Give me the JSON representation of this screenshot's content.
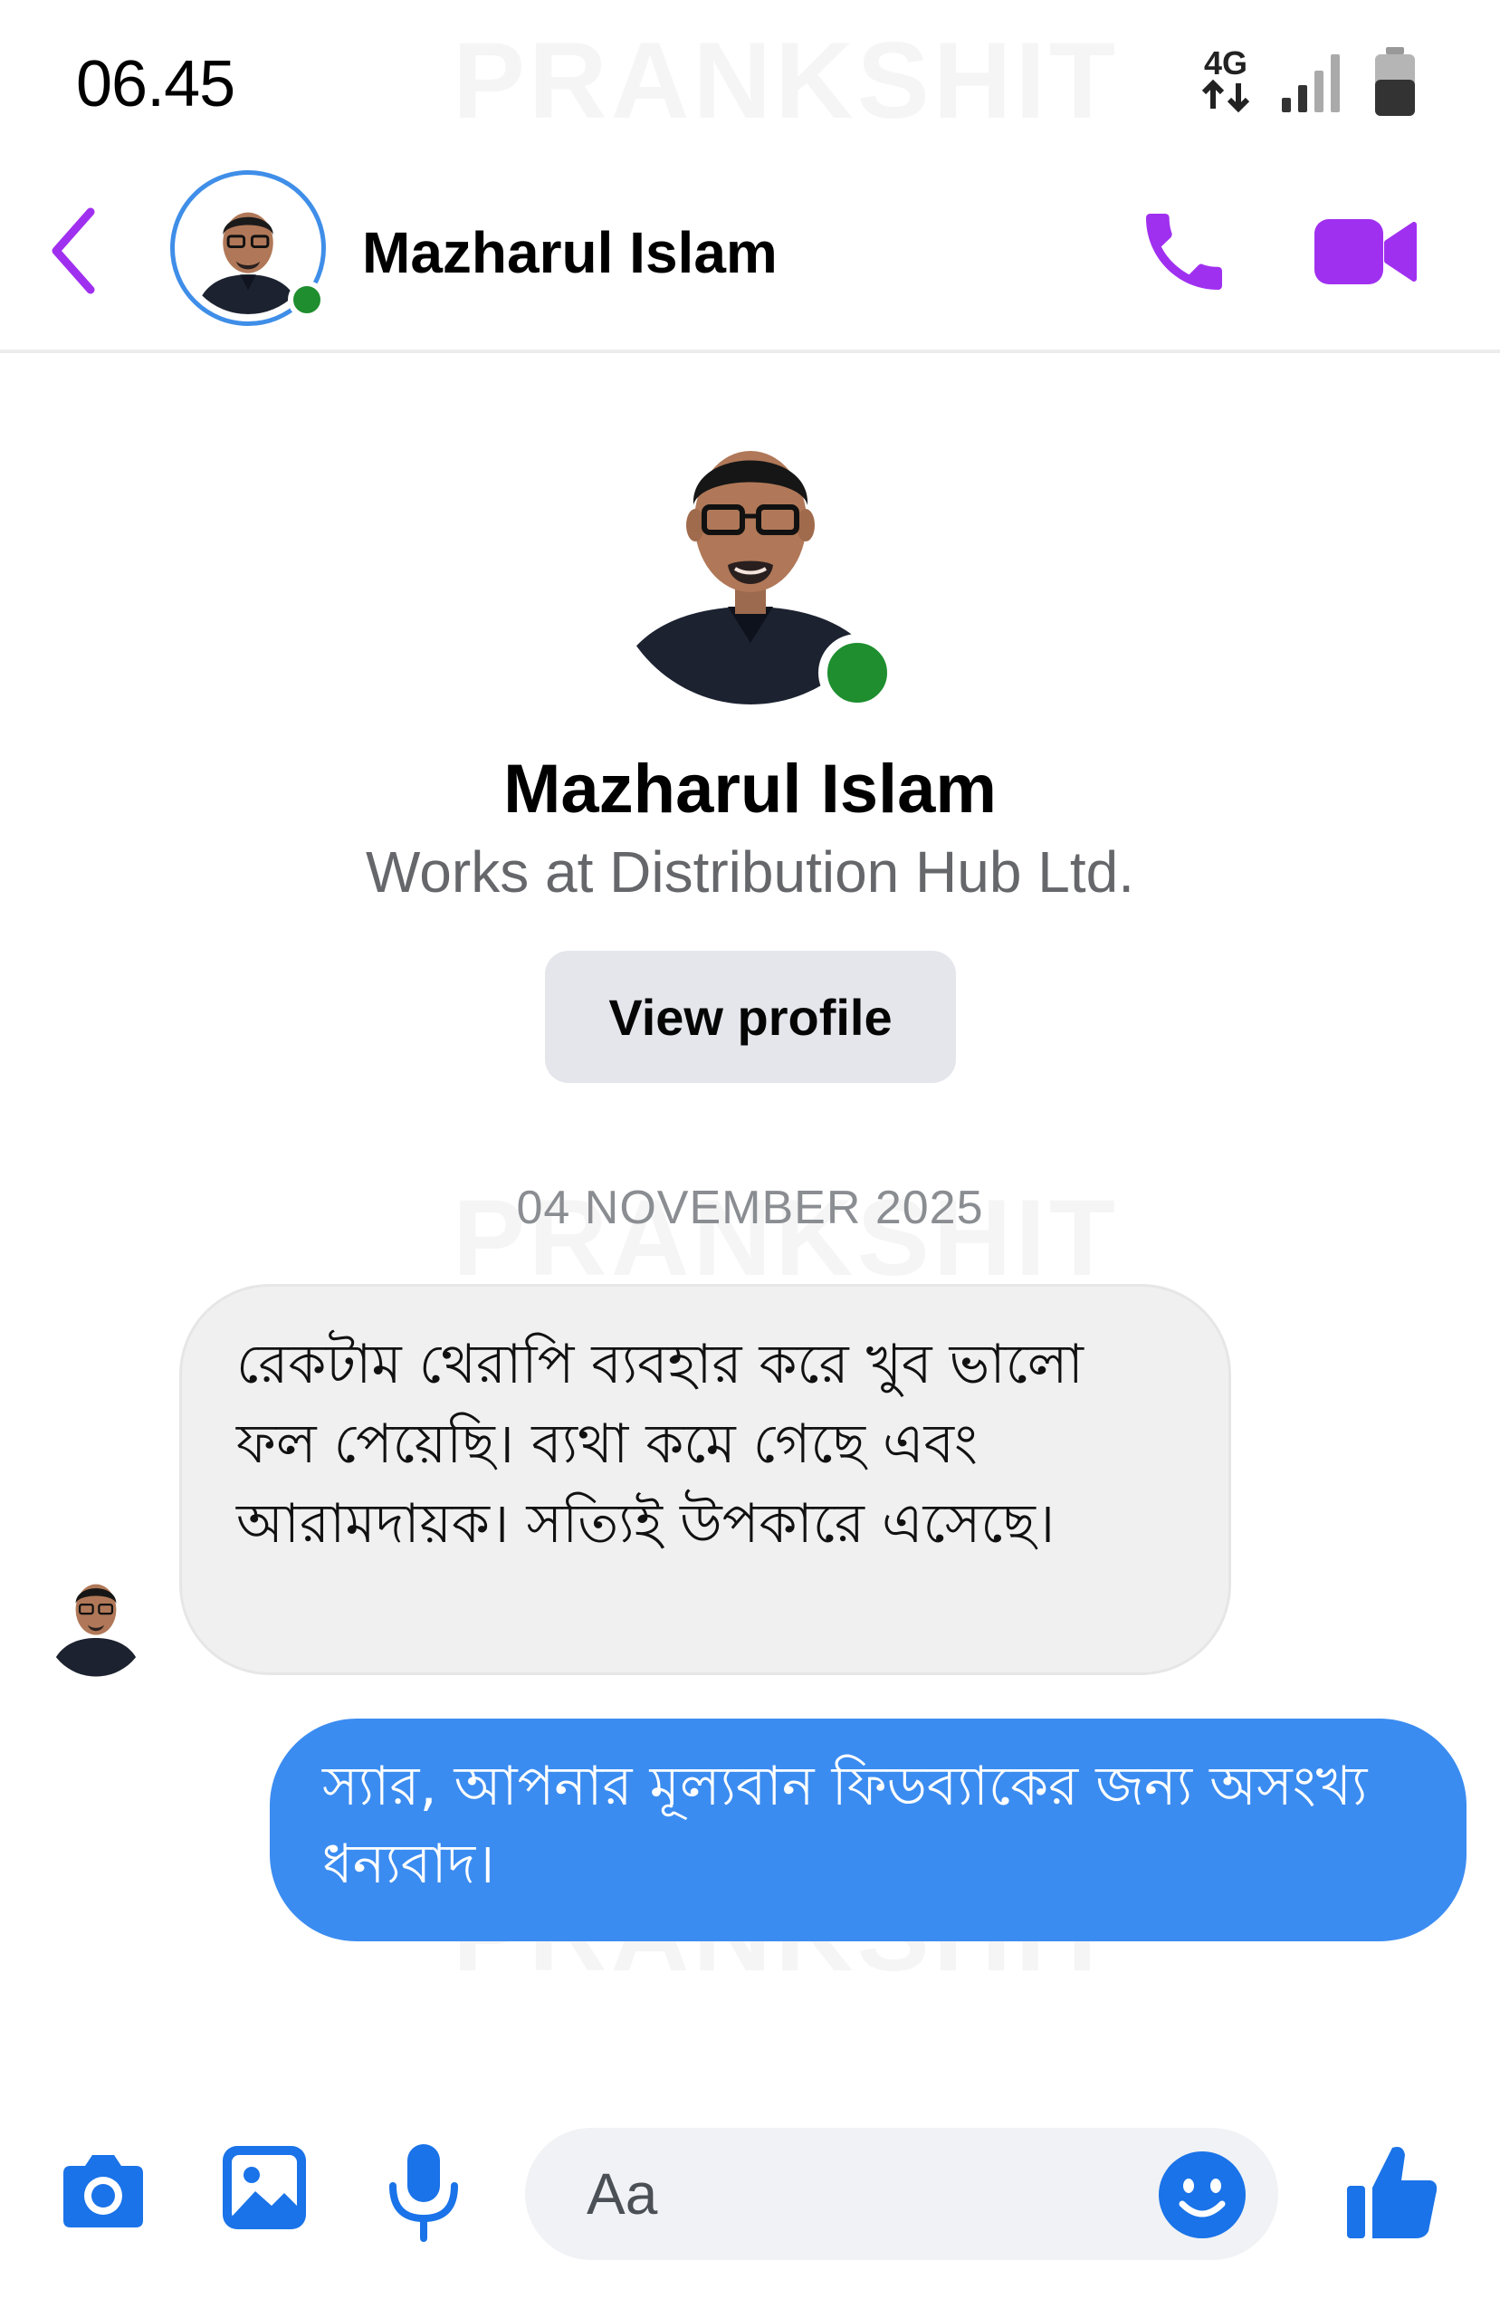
{
  "status_bar": {
    "time": "06.45",
    "network": "4G"
  },
  "watermark": "PRANKSHIT",
  "header": {
    "contact_name": "Mazharul Islam",
    "online": true
  },
  "profile": {
    "name": "Mazharul Islam",
    "subtitle": "Works at Distribution Hub Ltd.",
    "view_profile_label": "View profile"
  },
  "conversation": {
    "date": "04 NOVEMBER 2025",
    "messages": [
      {
        "direction": "incoming",
        "text": "রেকটাম থেরাপি ব্যবহার করে খুব ভালো ফল পেয়েছি। ব্যথা কমে গেছে এবং আরামদায়ক। সত্যিই উপকারে এসেছে।"
      },
      {
        "direction": "outgoing",
        "text": "স্যার, আপনার মূল্যবান ফিডব্যাকের জন্য অসংখ্য ধন্যবাদ।"
      }
    ]
  },
  "composer": {
    "placeholder": "Aa"
  },
  "colors": {
    "accent_purple": "#a030f0",
    "incoming_bubble": "#f0f0f0",
    "outgoing_bubble": "#3b8cf1",
    "composer_icons": "#1a73e8",
    "online": "#1e8e2f"
  },
  "icons": {
    "back": "chevron-left-icon",
    "call": "phone-icon",
    "video": "video-camera-icon",
    "camera": "camera-icon",
    "gallery": "image-icon",
    "mic": "microphone-icon",
    "emoji": "smiley-icon",
    "like": "thumbs-up-icon"
  }
}
